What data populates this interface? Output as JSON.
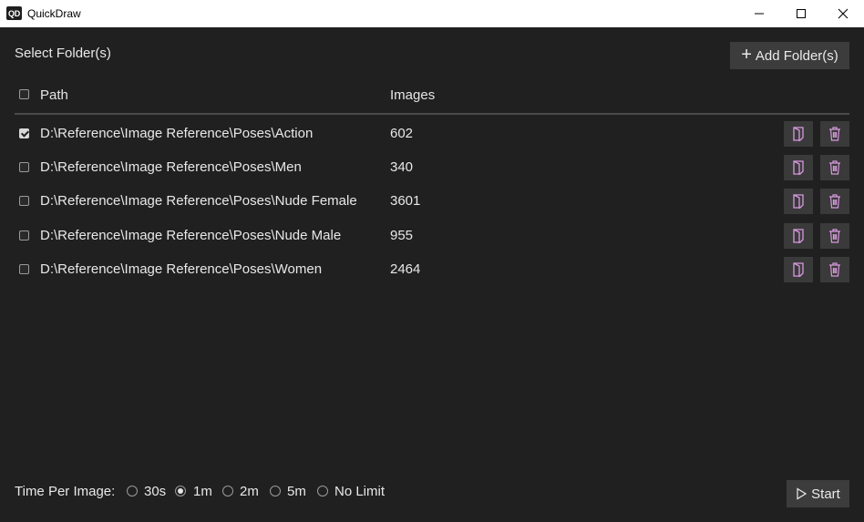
{
  "window": {
    "app_icon_text": "QD",
    "title": "QuickDraw"
  },
  "header": {
    "select_label": "Select Folder(s)",
    "add_button_label": "Add Folder(s)"
  },
  "table": {
    "columns": [
      "Path",
      "Images"
    ],
    "rows": [
      {
        "path": "D:\\Reference\\Image Reference\\Poses\\Action",
        "images": "602",
        "checked": true
      },
      {
        "path": "D:\\Reference\\Image Reference\\Poses\\Men",
        "images": "340",
        "checked": false
      },
      {
        "path": "D:\\Reference\\Image Reference\\Poses\\Nude Female",
        "images": "3601",
        "checked": false
      },
      {
        "path": "D:\\Reference\\Image Reference\\Poses\\Nude Male",
        "images": "955",
        "checked": false
      },
      {
        "path": "D:\\Reference\\Image Reference\\Poses\\Women",
        "images": "2464",
        "checked": false
      }
    ],
    "row_icons": [
      "open-folder-icon",
      "trash-icon"
    ],
    "icon_color": "#d89adf"
  },
  "footer": {
    "time_label": "Time Per Image:",
    "options": [
      "30s",
      "1m",
      "2m",
      "5m",
      "No Limit"
    ],
    "selected": "1m",
    "start_label": "Start"
  },
  "colors": {
    "background": "#202020",
    "button": "#3c3c3c",
    "text": "#e6e6e6",
    "accent_icon": "#d89adf"
  }
}
